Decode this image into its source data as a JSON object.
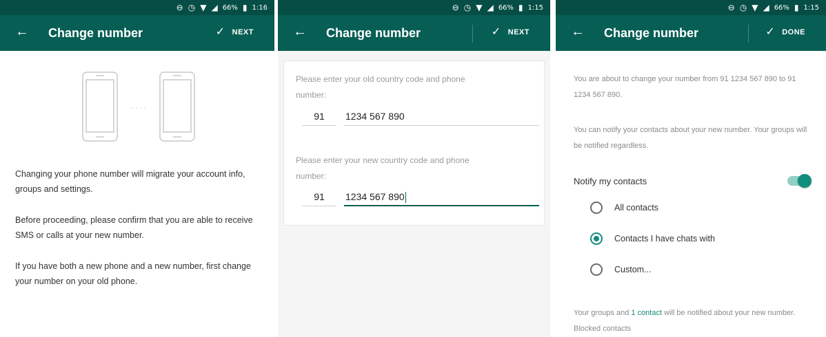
{
  "status_bar": {
    "screen1": {
      "battery": "66%",
      "time": "1:16"
    },
    "screen2": {
      "battery": "66%",
      "time": "1:15"
    },
    "screen3": {
      "battery": "66%",
      "time": "1:15"
    }
  },
  "screen1": {
    "title": "Change number",
    "action_label": "NEXT",
    "paragraphs": [
      "Changing your phone number will migrate your account info, groups and settings.",
      "Before proceeding, please confirm that you are able to receive SMS or calls at your new number.",
      "If you have both a new phone and a new number, first change your number on your old phone."
    ],
    "illustration_dots": ". . . ."
  },
  "screen2": {
    "title": "Change number",
    "action_label": "NEXT",
    "old_prompt": "Please enter your old country code and phone number:",
    "old_country_code": "91",
    "old_phone": "1234 567 890",
    "new_prompt": "Please enter your new country code and phone number:",
    "new_country_code": "91",
    "new_phone": "1234 567 890"
  },
  "screen3": {
    "title": "Change number",
    "action_label": "DONE",
    "info_text": "You are about to change your number from 91 1234 567 890 to 91 1234 567 890.",
    "notify_info": "You can notify your contacts about your new number. Your groups will be notified regardless.",
    "notify_label": "Notify my contacts",
    "notify_enabled": true,
    "radio_options": [
      {
        "label": "All contacts",
        "selected": false
      },
      {
        "label": "Contacts I have chats with",
        "selected": true
      },
      {
        "label": "Custom...",
        "selected": false
      }
    ],
    "footer_prefix": "Your groups and ",
    "footer_link": "1 contact",
    "footer_suffix": " will be notified about your new number. Blocked contacts"
  },
  "colors": {
    "status_bar": "#064e45",
    "app_bar": "#075e54",
    "accent": "#128c7e"
  }
}
